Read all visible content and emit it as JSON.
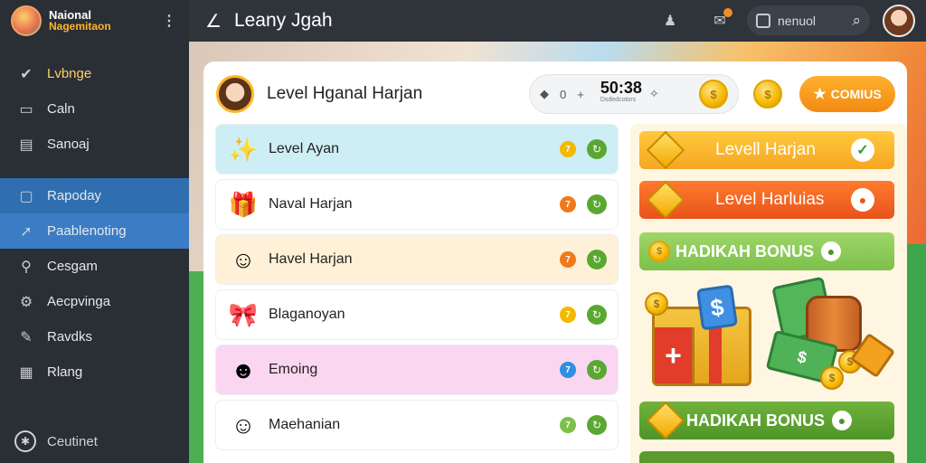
{
  "app": {
    "title": "Leany Jgah",
    "brand_title": "Naional",
    "brand_subtitle": "Nagemitaon"
  },
  "sidebar": {
    "items": [
      {
        "label": "Lvbnge",
        "icon": "check-badge-icon"
      },
      {
        "label": "Caln",
        "icon": "monitor-icon"
      },
      {
        "label": "Sanoaj",
        "icon": "document-icon"
      },
      {
        "label": "Rapoday",
        "icon": "folder-icon"
      },
      {
        "label": "Paablenoting",
        "icon": "pin-icon"
      },
      {
        "label": "Cesgam",
        "icon": "key-icon"
      },
      {
        "label": "Aecpvinga",
        "icon": "gear-icon"
      },
      {
        "label": "Ravdks",
        "icon": "tag-icon"
      },
      {
        "label": "Rlang",
        "icon": "clipboard-icon"
      }
    ],
    "footer_label": "Ceutinet"
  },
  "topbar": {
    "search_text": "nenuol"
  },
  "header": {
    "title": "Level Hganal Harjan",
    "timer_value": "50:38",
    "timer_sub": "Dsdedcotors",
    "pill_small": "0",
    "bonus_label": "COMIUS"
  },
  "list": {
    "rows": [
      {
        "label": "Level Ayan",
        "icon": "star-cluster-icon",
        "badge": "7",
        "badge_color": "#f5b800",
        "theme": "r-cyan"
      },
      {
        "label": "Naval Harjan",
        "icon": "gift-box-icon",
        "badge": "7",
        "badge_color": "#f07a1a",
        "theme": "r-white"
      },
      {
        "label": "Havel Harjan",
        "icon": "character-icon",
        "badge": "7",
        "badge_color": "#f07a1a",
        "theme": "r-peach"
      },
      {
        "label": "Blaganoyan",
        "icon": "present-icon",
        "badge": "7",
        "badge_color": "#f5b800",
        "theme": "r-white"
      },
      {
        "label": "Emoing",
        "icon": "girl-avatar-icon",
        "badge": "7",
        "badge_color": "#2f8fe3",
        "theme": "r-pink"
      },
      {
        "label": "Maehanian",
        "icon": "boy-avatar-icon",
        "badge": "7",
        "badge_color": "#7cc04a",
        "theme": "r-white"
      }
    ]
  },
  "rewards": {
    "btn1": "Levell Harjan",
    "btn2": "Level Harluias",
    "bonus1": "HADIKAH BONUS",
    "bonus2": "HADIKAH BONUS"
  },
  "colors": {
    "accent_orange": "#f28a12",
    "sidebar_active": "#2f6fb0",
    "reward_green": "#4f9428"
  }
}
